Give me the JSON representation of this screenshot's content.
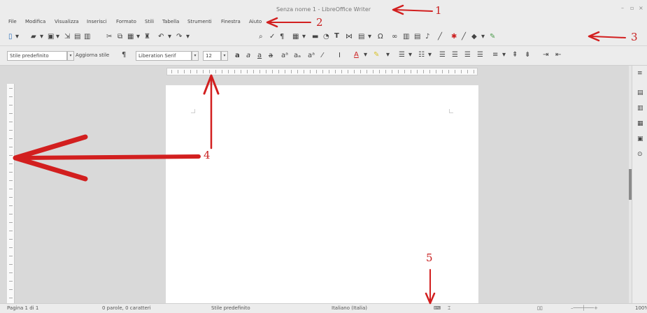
{
  "window": {
    "title": "Senza nome 1 - LibreOffice Writer",
    "controls": [
      "–",
      "▫",
      "×"
    ]
  },
  "menu": {
    "items": [
      "File",
      "Modifica",
      "Visualizza",
      "Inserisci",
      "Formato",
      "Stili",
      "Tabella",
      "Strumenti",
      "Finestra",
      "Aiuto"
    ]
  },
  "formatting": {
    "paragraph_style": "Stile predefinito",
    "update_style": "Aggiorna stile",
    "font_name": "Liberation Serif",
    "font_size": "12"
  },
  "status": {
    "page": "Pagina 1 di 1",
    "words": "0 parole, 0 caratteri",
    "page_style": "Stile predefinito",
    "language": "Italiano (Italia)",
    "zoom": "100%"
  },
  "annotations": [
    "1",
    "2",
    "3",
    "4",
    "5"
  ],
  "colors": {
    "annotation": "#d21f1f",
    "chrome": "#ececec",
    "workspace": "#d9d9d9",
    "page": "#ffffff"
  }
}
